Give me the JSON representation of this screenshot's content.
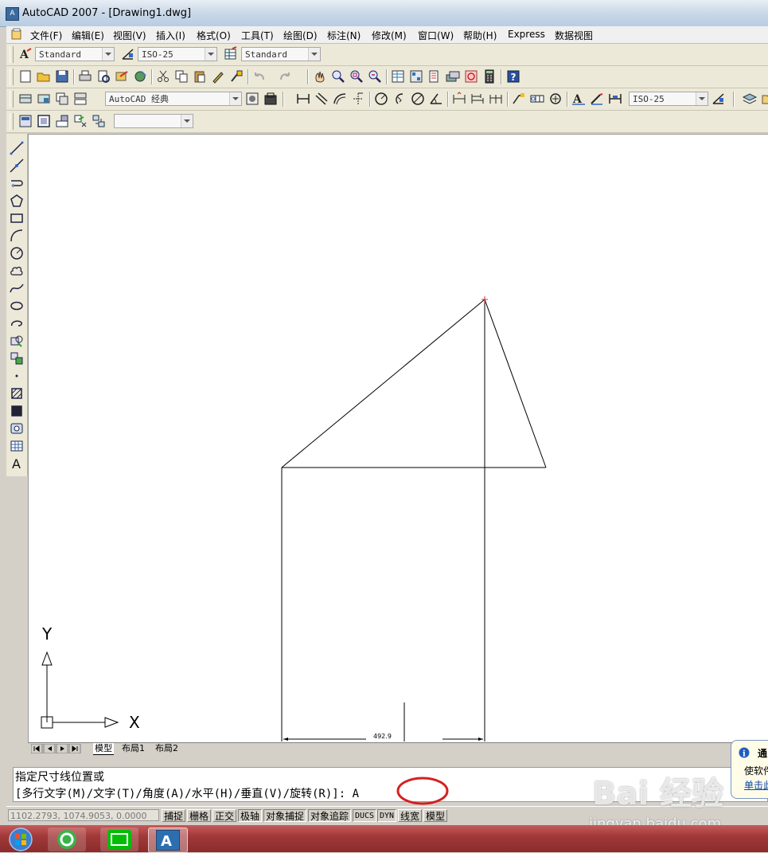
{
  "window": {
    "title": "AutoCAD 2007 - [Drawing1.dwg]"
  },
  "menu": [
    "文件(F)",
    "编辑(E)",
    "视图(V)",
    "插入(I)",
    "格式(O)",
    "工具(T)",
    "绘图(D)",
    "标注(N)",
    "修改(M)",
    "窗口(W)",
    "帮助(H)",
    "Express",
    "数据视图"
  ],
  "toolbar1": {
    "text_style": "Standard",
    "dim_style": "ISO-25",
    "table_style": "Standard"
  },
  "toolbar3": {
    "workspace": "AutoCAD 经典",
    "dim_style2": "ISO-25"
  },
  "toolbar4": {
    "layer_value": ""
  },
  "drawing": {
    "dimension_text": "492.9",
    "ucs_y": "Y",
    "ucs_x": "X"
  },
  "tabs": [
    "模型",
    "布局1",
    "布局2"
  ],
  "command": {
    "line1": "指定尺寸线位置或",
    "line2": "[多行文字(M)/文字(T)/角度(A)/水平(H)/垂直(V)/旋转(R)]: A"
  },
  "status": {
    "coords": "1102.2793, 1074.9053, 0.0000",
    "buttons": [
      "捕捉",
      "栅格",
      "正交",
      "极轴",
      "对象捕捉",
      "对象追踪",
      "DUCS",
      "DYN",
      "线宽",
      "模型"
    ]
  },
  "notification": {
    "line1": "通",
    "line2": "使软件",
    "line3": "单击此"
  },
  "watermark": {
    "brand": "Bai 经验",
    "url": "jingyan.baidu.com"
  },
  "colors": {
    "accent_red": "#d42020",
    "taskbar": "#a23a3a"
  }
}
